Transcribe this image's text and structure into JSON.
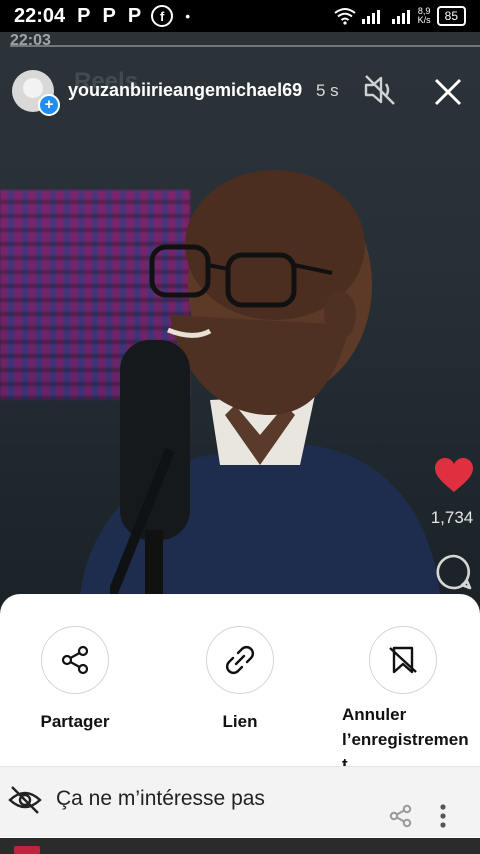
{
  "status_bar": {
    "time": "22:04",
    "notif_p1": "P",
    "notif_p2": "P",
    "notif_p3": "P",
    "facebook_glyph": "f",
    "dot": "•",
    "speed_top": "8,9",
    "speed_bottom": "K/s",
    "battery": "85"
  },
  "ghost_bar": {
    "time": "22:03"
  },
  "story": {
    "background_label": "Reels",
    "username": "youzanbiirieangemichael69",
    "age": "5 s",
    "icons": [
      "avatar",
      "add-story-icon",
      "mute-icon",
      "close-icon"
    ]
  },
  "side_actions": {
    "like_count": "1,734",
    "like_color": "#e0303f",
    "icons": [
      "heart-icon",
      "comment-icon"
    ]
  },
  "sheet": {
    "actions": [
      {
        "label": "Partager",
        "icon": "share-icon"
      },
      {
        "label": "Lien",
        "icon": "link-icon"
      },
      {
        "label": "Annuler\nl’enregistremen\nt",
        "icon": "unsave-icon"
      }
    ],
    "not_interested": "Ça ne m’intéresse pas",
    "icons": [
      "eye-off-icon",
      "share-small-icon",
      "more-icon"
    ]
  }
}
